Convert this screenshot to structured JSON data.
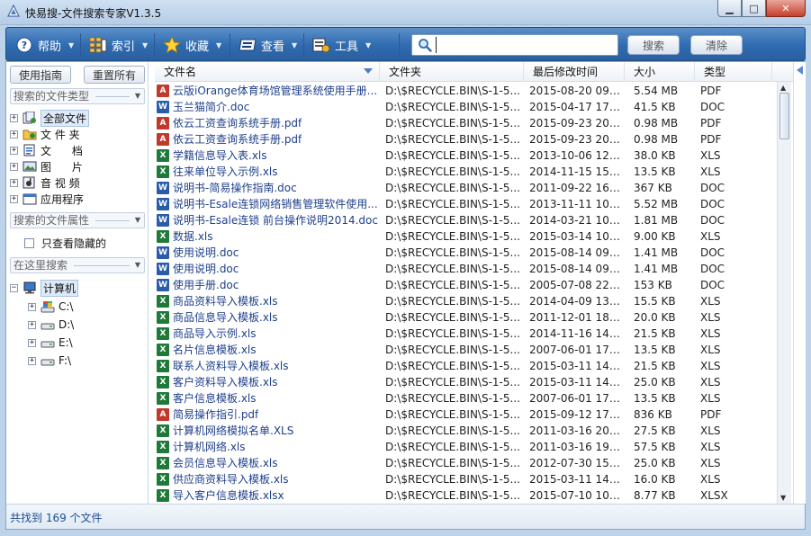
{
  "window": {
    "title": "快易搜-文件搜索专家V1.3.5",
    "controls": {
      "minimize": "▁",
      "maximize": "□",
      "close": "✕"
    }
  },
  "toolbar": {
    "help_label": "帮助",
    "index_label": "索引",
    "favorites_label": "收藏",
    "view_label": "查看",
    "tools_label": "工具",
    "search_value": "",
    "search_button": "搜索",
    "clear_button": "清除"
  },
  "sidebar": {
    "guide_button": "使用指南",
    "reset_button": "重置所有",
    "type_section": "搜索的文件类型",
    "types": [
      {
        "label": "全部文件",
        "icon": "all-files-icon"
      },
      {
        "label": "文 件 夹",
        "icon": "folder-icon"
      },
      {
        "label": "文      档",
        "icon": "document-icon"
      },
      {
        "label": "图      片",
        "icon": "image-icon"
      },
      {
        "label": "音 视 频",
        "icon": "media-icon"
      },
      {
        "label": "应用程序",
        "icon": "application-icon"
      }
    ],
    "attr_section": "搜索的文件属性",
    "hidden_only_label": "只查看隐藏的",
    "location_section": "在这里搜索",
    "computer_label": "计算机",
    "drives": [
      "C:\\",
      "D:\\",
      "E:\\",
      "F:\\"
    ]
  },
  "table": {
    "columns": {
      "name": "文件名",
      "folder": "文件夹",
      "modified": "最后修改时间",
      "size": "大小",
      "type": "类型"
    },
    "rows": [
      {
        "name": "云版iOrange体育场馆管理系统使用手册...",
        "folder": "D:\\$RECYCLE.BIN\\S-1-5...",
        "modified": "2015-08-20 09:...",
        "size": "5.54 MB",
        "type": "PDF"
      },
      {
        "name": "玉兰猫简介.doc",
        "folder": "D:\\$RECYCLE.BIN\\S-1-5...",
        "modified": "2015-04-17 17:...",
        "size": "41.5 KB",
        "type": "DOC"
      },
      {
        "name": "依云工资查询系统手册.pdf",
        "folder": "D:\\$RECYCLE.BIN\\S-1-5...",
        "modified": "2015-09-23 20:...",
        "size": "0.98 MB",
        "type": "PDF"
      },
      {
        "name": "依云工资查询系统手册.pdf",
        "folder": "D:\\$RECYCLE.BIN\\S-1-5...",
        "modified": "2015-09-23 20:...",
        "size": "0.98 MB",
        "type": "PDF"
      },
      {
        "name": "学籍信息导入表.xls",
        "folder": "D:\\$RECYCLE.BIN\\S-1-5...",
        "modified": "2013-10-06 12:...",
        "size": "38.0 KB",
        "type": "XLS"
      },
      {
        "name": "往来单位导入示例.xls",
        "folder": "D:\\$RECYCLE.BIN\\S-1-5...",
        "modified": "2014-11-15 15:...",
        "size": "13.5 KB",
        "type": "XLS"
      },
      {
        "name": "说明书-简易操作指南.doc",
        "folder": "D:\\$RECYCLE.BIN\\S-1-5...",
        "modified": "2011-09-22 16:...",
        "size": "367 KB",
        "type": "DOC"
      },
      {
        "name": "说明书-Esale连锁网络销售管理软件使用...",
        "folder": "D:\\$RECYCLE.BIN\\S-1-5...",
        "modified": "2013-11-11 10:...",
        "size": "5.52 MB",
        "type": "DOC"
      },
      {
        "name": "说明书-Esale连锁 前台操作说明2014.doc",
        "folder": "D:\\$RECYCLE.BIN\\S-1-5...",
        "modified": "2014-03-21 10:...",
        "size": "1.81 MB",
        "type": "DOC"
      },
      {
        "name": "数据.xls",
        "folder": "D:\\$RECYCLE.BIN\\S-1-5...",
        "modified": "2015-03-14 10:...",
        "size": "9.00 KB",
        "type": "XLS"
      },
      {
        "name": "使用说明.doc",
        "folder": "D:\\$RECYCLE.BIN\\S-1-5...",
        "modified": "2015-08-14 09:...",
        "size": "1.41 MB",
        "type": "DOC"
      },
      {
        "name": "使用说明.doc",
        "folder": "D:\\$RECYCLE.BIN\\S-1-5...",
        "modified": "2015-08-14 09:...",
        "size": "1.41 MB",
        "type": "DOC"
      },
      {
        "name": "使用手册.doc",
        "folder": "D:\\$RECYCLE.BIN\\S-1-5...",
        "modified": "2005-07-08 22:...",
        "size": "153 KB",
        "type": "DOC"
      },
      {
        "name": "商品资料导入模板.xls",
        "folder": "D:\\$RECYCLE.BIN\\S-1-5...",
        "modified": "2014-04-09 13:...",
        "size": "15.5 KB",
        "type": "XLS"
      },
      {
        "name": "商品信息导入模板.xls",
        "folder": "D:\\$RECYCLE.BIN\\S-1-5...",
        "modified": "2011-12-01 18:...",
        "size": "20.0 KB",
        "type": "XLS"
      },
      {
        "name": "商品导入示例.xls",
        "folder": "D:\\$RECYCLE.BIN\\S-1-5...",
        "modified": "2014-11-16 14:...",
        "size": "21.5 KB",
        "type": "XLS"
      },
      {
        "name": "名片信息模板.xls",
        "folder": "D:\\$RECYCLE.BIN\\S-1-5...",
        "modified": "2007-06-01 17:...",
        "size": "13.5 KB",
        "type": "XLS"
      },
      {
        "name": "联系人资料导入模板.xls",
        "folder": "D:\\$RECYCLE.BIN\\S-1-5...",
        "modified": "2015-03-11 14:...",
        "size": "21.5 KB",
        "type": "XLS"
      },
      {
        "name": "客户资料导入模板.xls",
        "folder": "D:\\$RECYCLE.BIN\\S-1-5...",
        "modified": "2015-03-11 14:...",
        "size": "25.0 KB",
        "type": "XLS"
      },
      {
        "name": "客户信息模板.xls",
        "folder": "D:\\$RECYCLE.BIN\\S-1-5...",
        "modified": "2007-06-01 17:...",
        "size": "13.5 KB",
        "type": "XLS"
      },
      {
        "name": "简易操作指引.pdf",
        "folder": "D:\\$RECYCLE.BIN\\S-1-5...",
        "modified": "2015-09-12 17:...",
        "size": "836 KB",
        "type": "PDF"
      },
      {
        "name": "计算机网络模拟名单.XLS",
        "folder": "D:\\$RECYCLE.BIN\\S-1-5...",
        "modified": "2011-03-16 20:...",
        "size": "27.5 KB",
        "type": "XLS"
      },
      {
        "name": "计算机网络.xls",
        "folder": "D:\\$RECYCLE.BIN\\S-1-5...",
        "modified": "2011-03-16 19:...",
        "size": "57.5 KB",
        "type": "XLS"
      },
      {
        "name": "会员信息导入模板.xls",
        "folder": "D:\\$RECYCLE.BIN\\S-1-5...",
        "modified": "2012-07-30 15:...",
        "size": "25.0 KB",
        "type": "XLS"
      },
      {
        "name": "供应商资料导入模板.xls",
        "folder": "D:\\$RECYCLE.BIN\\S-1-5...",
        "modified": "2015-03-11 14:...",
        "size": "16.0 KB",
        "type": "XLS"
      },
      {
        "name": "导入客户信息模板.xlsx",
        "folder": "D:\\$RECYCLE.BIN\\S-1-5...",
        "modified": "2015-07-10 10:...",
        "size": "8.77 KB",
        "type": "XLSX"
      }
    ]
  },
  "status": {
    "text": "共找到 169 个文件"
  },
  "colors": {
    "accent": "#2f6bb0",
    "link": "#1e3f8c",
    "pdf": "#c0392b",
    "doc": "#2b5cab",
    "xls": "#1f7a3a"
  }
}
